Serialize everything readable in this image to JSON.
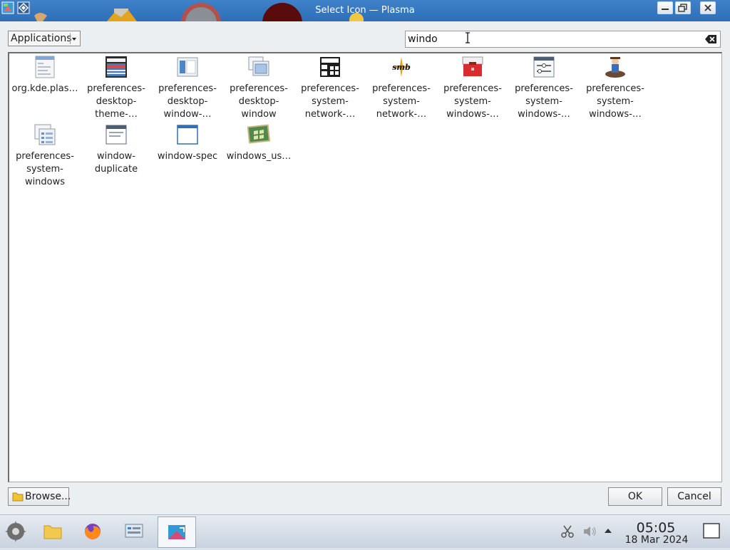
{
  "window": {
    "title": "Select Icon — Plasma"
  },
  "toolbar": {
    "category": "Applications"
  },
  "search": {
    "value": "windo",
    "placeholder": ""
  },
  "icons": [
    {
      "label": "org.kde.plas…",
      "icon": "document-list-icon"
    },
    {
      "label": "preferences-desktop-theme-…",
      "icon": "theme-preview-icon"
    },
    {
      "label": "preferences-desktop-window-…",
      "icon": "window-icon"
    },
    {
      "label": "preferences-desktop-window",
      "icon": "windows-stack-icon"
    },
    {
      "label": "preferences-system-network-…",
      "icon": "network-grid-icon"
    },
    {
      "label": "preferences-system-network-…",
      "icon": "smb-icon"
    },
    {
      "label": "preferences-system-windows-…",
      "icon": "toolbox-icon"
    },
    {
      "label": "preferences-system-windows-…",
      "icon": "window-settings-icon"
    },
    {
      "label": "preferences-system-windows-…",
      "icon": "character-icon"
    },
    {
      "label": "preferences-system-windows",
      "icon": "windows-list-icon"
    },
    {
      "label": "window-duplicate",
      "icon": "window-duplicate-icon"
    },
    {
      "label": "window-spec",
      "icon": "window-spec-icon"
    },
    {
      "label": "windows_us…",
      "icon": "windows-logo-icon"
    }
  ],
  "buttons": {
    "browse": "Browse...",
    "ok": "OK",
    "cancel": "Cancel"
  },
  "taskbar": {
    "apps": [
      "system-settings-icon",
      "folder-icon",
      "firefox-icon",
      "system-monitor-icon",
      "image-editor-icon"
    ],
    "clock_time": "05:05",
    "clock_date": "18 Mar 2024"
  },
  "colors": {
    "titlebar": "#3a7bc5",
    "accent": "#2e6fb7"
  }
}
